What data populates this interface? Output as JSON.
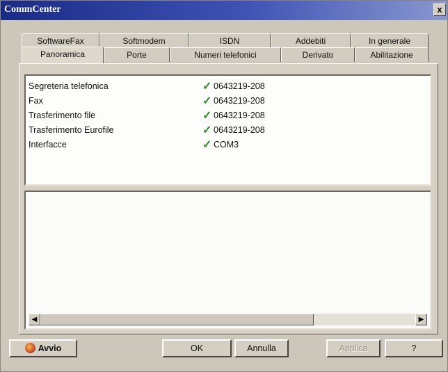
{
  "window": {
    "title": "CommCenter",
    "close_glyph": "x"
  },
  "tabs_top": [
    "SoftwareFax",
    "Softmodem",
    "ISDN",
    "Addebiti",
    "In generale"
  ],
  "tabs_bottom": [
    "Panoramica",
    "Porte",
    "Numeri telefonici",
    "Derivato",
    "Abilitazione"
  ],
  "active_tab": "Panoramica",
  "overview": {
    "rows": [
      {
        "name": "Segreteria telefonica",
        "value": "0643219-208",
        "status_icon": "check-icon"
      },
      {
        "name": "Fax",
        "value": "0643219-208",
        "status_icon": "check-icon"
      },
      {
        "name": "Trasferimento file",
        "value": "0643219-208",
        "status_icon": "check-icon"
      },
      {
        "name": "Trasferimento Eurofile",
        "value": "0643219-208",
        "status_icon": "check-icon"
      },
      {
        "name": "Interfacce",
        "value": "COM3",
        "status_icon": "check-icon"
      }
    ],
    "check_glyph": "✓"
  },
  "scrollbar": {
    "left_glyph": "◀",
    "right_glyph": "▶"
  },
  "buttons": {
    "avvio": "Avvio",
    "ok": "OK",
    "annulla": "Annulla",
    "applica": "Applica",
    "help": "?"
  },
  "colors": {
    "titlebar": "#1a2b86",
    "check": "#2f8a2a",
    "panel": "#d7d0c4"
  }
}
